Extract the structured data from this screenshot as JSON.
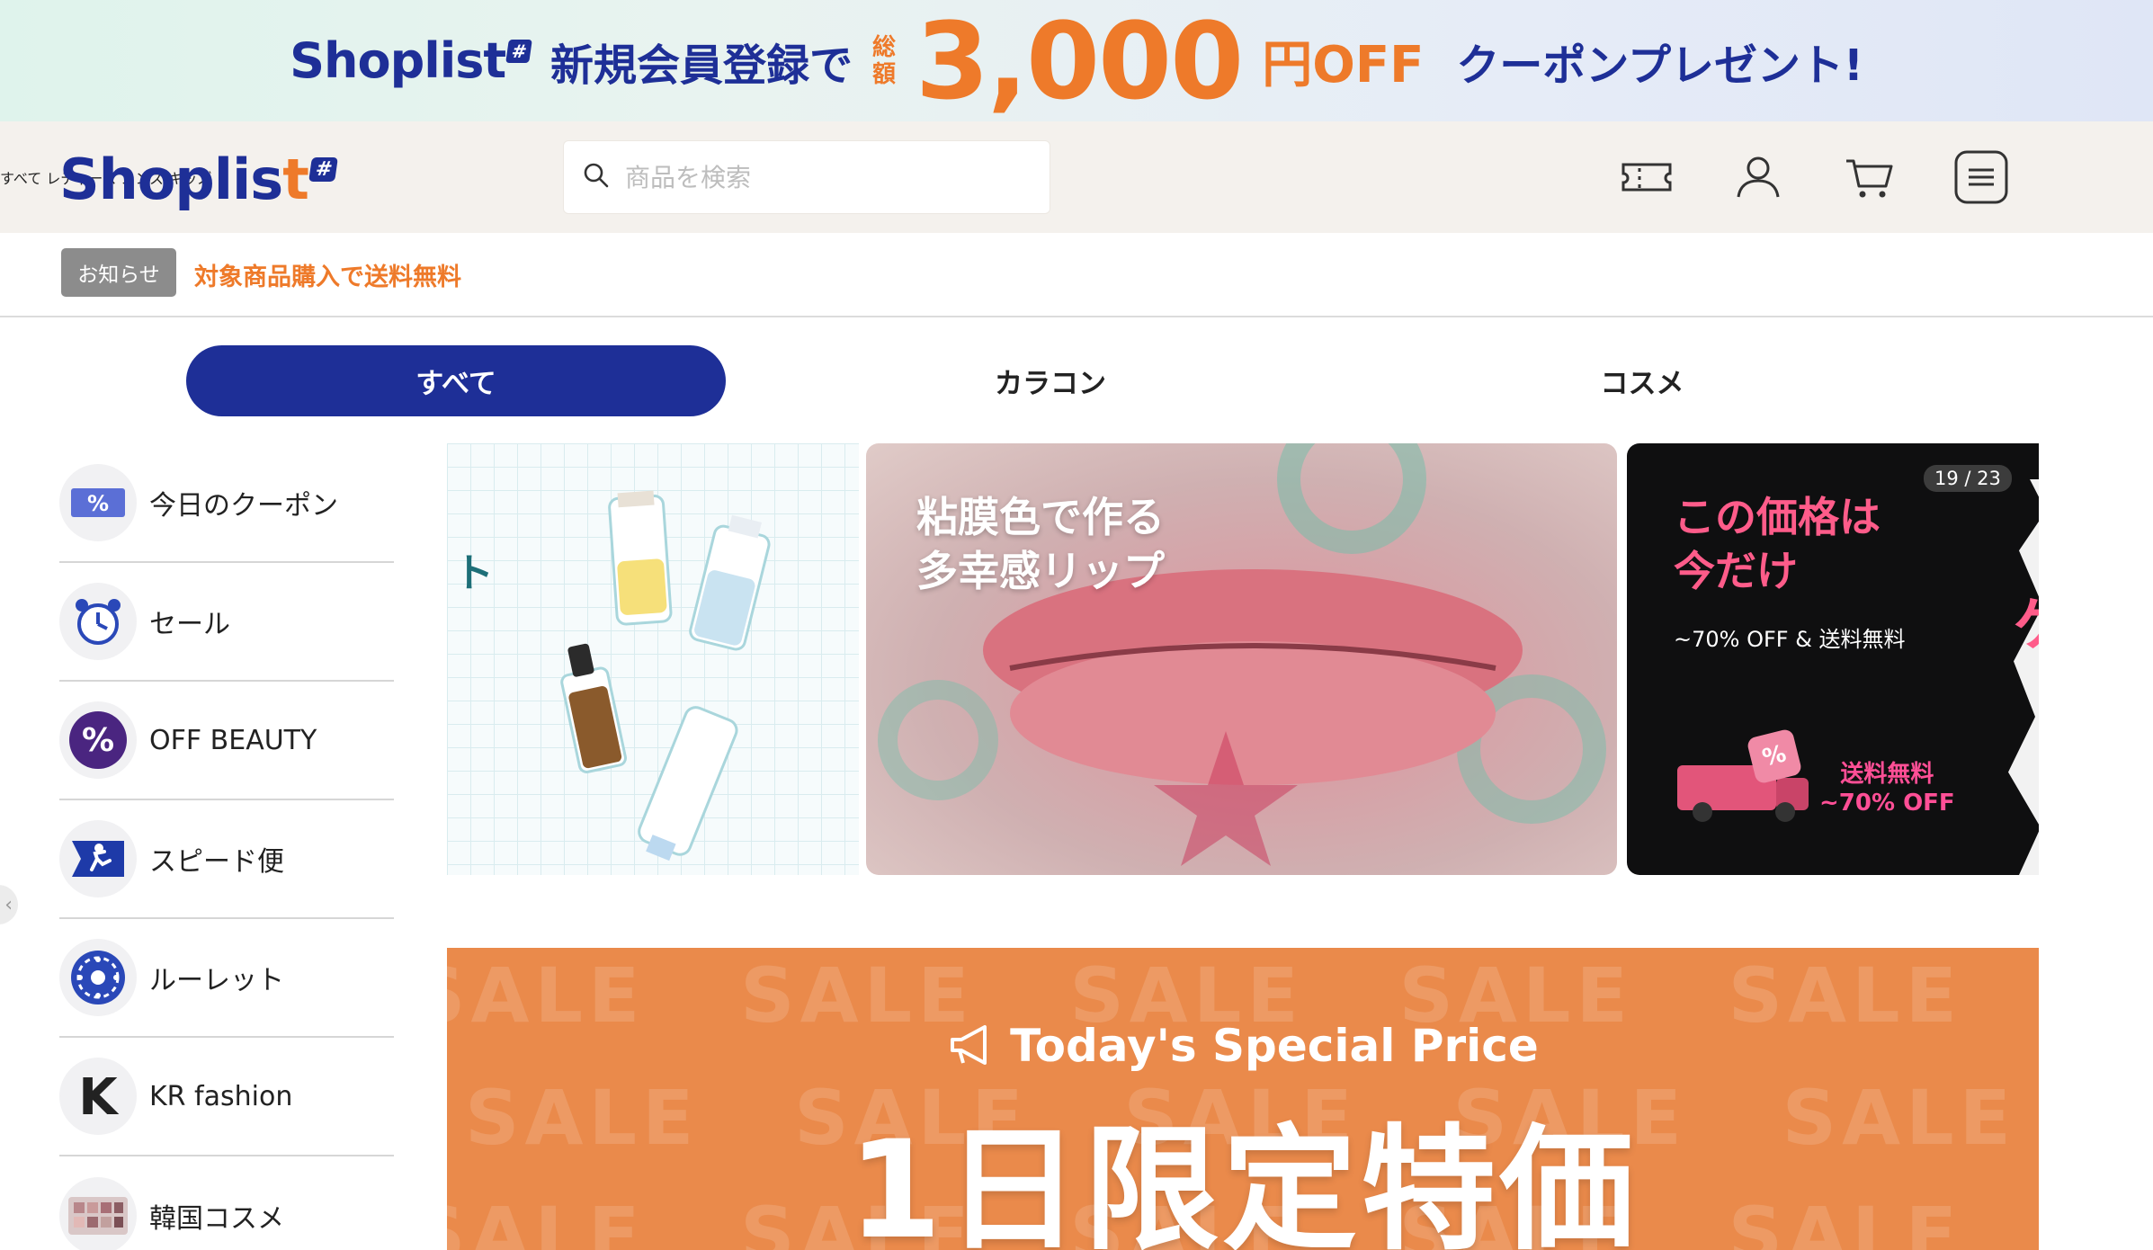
{
  "promo": {
    "brand": "Shoplist",
    "brand_hash": "#",
    "msg": "新規会員登録で",
    "small_top": "総",
    "small_bottom": "額",
    "amount": "3,000",
    "unit": "円OFF",
    "coupon": "クーポンプレゼント!"
  },
  "header": {
    "logo_main": "Shoplis",
    "logo_st": "t",
    "logo_hash": "#",
    "search_placeholder": "商品を検索",
    "nav": [
      "すべて",
      "レディース",
      "メンズ",
      "キッズ"
    ]
  },
  "notice": {
    "tag": "お知らせ",
    "text": "対象商品購入で送料無料"
  },
  "tabs": [
    "すべて",
    "カラコン",
    "コスメ"
  ],
  "sidebar": {
    "items": [
      {
        "label": "今日のクーポン",
        "icon": "coupon-percent-icon"
      },
      {
        "label": "セール",
        "icon": "alarm-clock-icon"
      },
      {
        "label": "OFF BEAUTY",
        "icon": "percent-circle-icon"
      },
      {
        "label": "スピード便",
        "icon": "running-man-icon"
      },
      {
        "label": "ルーレット",
        "icon": "roulette-icon"
      },
      {
        "label": "KR fashion",
        "icon": "k-letter-icon"
      },
      {
        "label": "韓国コスメ",
        "icon": "eyeshadow-palette-icon"
      }
    ]
  },
  "carousel": {
    "slide2_title": "粘膜色で作る\n多幸感リップ",
    "slide3_title": "この価格は\n今だけ",
    "slide3_sub": "~70% OFF & 送料無料",
    "slide3_counter": "19 / 23",
    "slide3_badge_1": "送料無料",
    "slide3_badge_2": "~70% OFF",
    "slide3_tear_char": "ゲ",
    "slide1_char": "ト"
  },
  "sale": {
    "watermark": "SALE",
    "subtitle": "Today's Special Price",
    "title": "1日限定特価"
  },
  "colors": {
    "brand_blue": "#1e2f97",
    "accent_orange": "#ee7a2a",
    "header_bg": "#f4f1ed",
    "sale_bg": "#ea8a4b"
  }
}
